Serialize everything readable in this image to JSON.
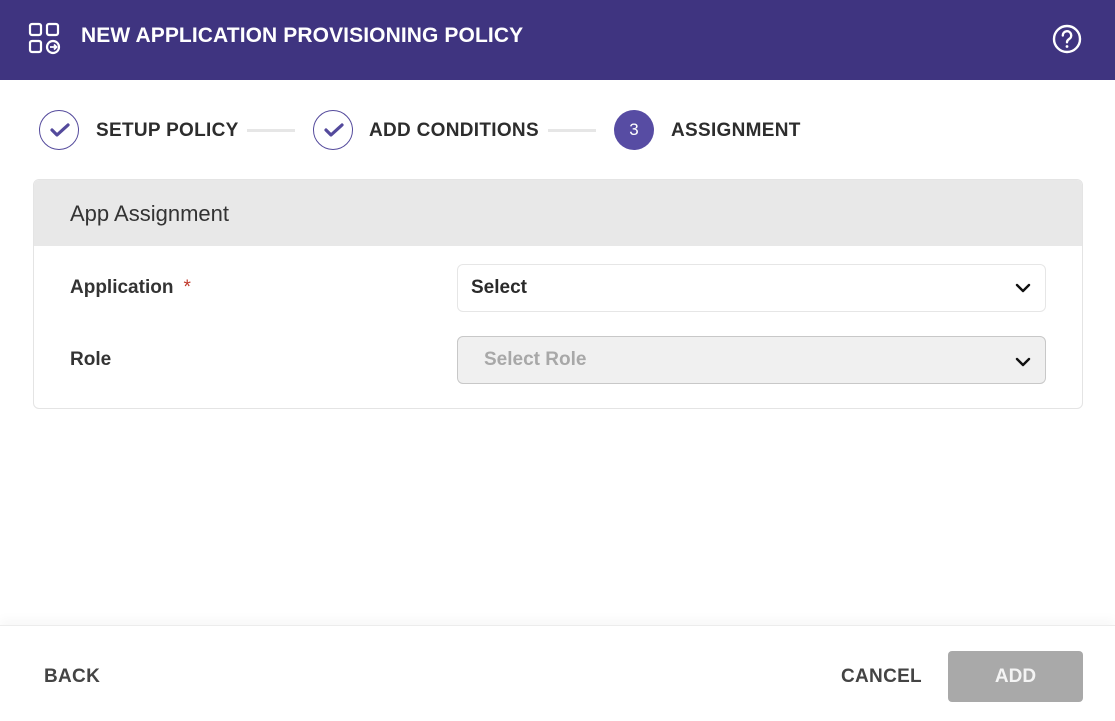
{
  "header": {
    "title": "NEW APPLICATION PROVISIONING POLICY",
    "icon": "app-grid-arrow-icon",
    "help_icon": "help-circle-icon",
    "background_color": "#3f3480"
  },
  "stepper": {
    "steps": [
      {
        "label": "SETUP POLICY",
        "status": "completed",
        "indicator": "check-icon"
      },
      {
        "label": "ADD CONDITIONS",
        "status": "completed",
        "indicator": "check-icon"
      },
      {
        "label": "ASSIGNMENT",
        "status": "active",
        "number": "3"
      }
    ],
    "accent_color": "#574ca3"
  },
  "card": {
    "title": "App Assignment",
    "fields": [
      {
        "label": "Application",
        "required": true,
        "required_mark": "*",
        "value": "Select",
        "disabled": false
      },
      {
        "label": "Role",
        "required": false,
        "placeholder": "Select Role",
        "disabled": true
      }
    ]
  },
  "footer": {
    "back_label": "BACK",
    "cancel_label": "CANCEL",
    "add_label": "ADD",
    "add_disabled": true
  }
}
